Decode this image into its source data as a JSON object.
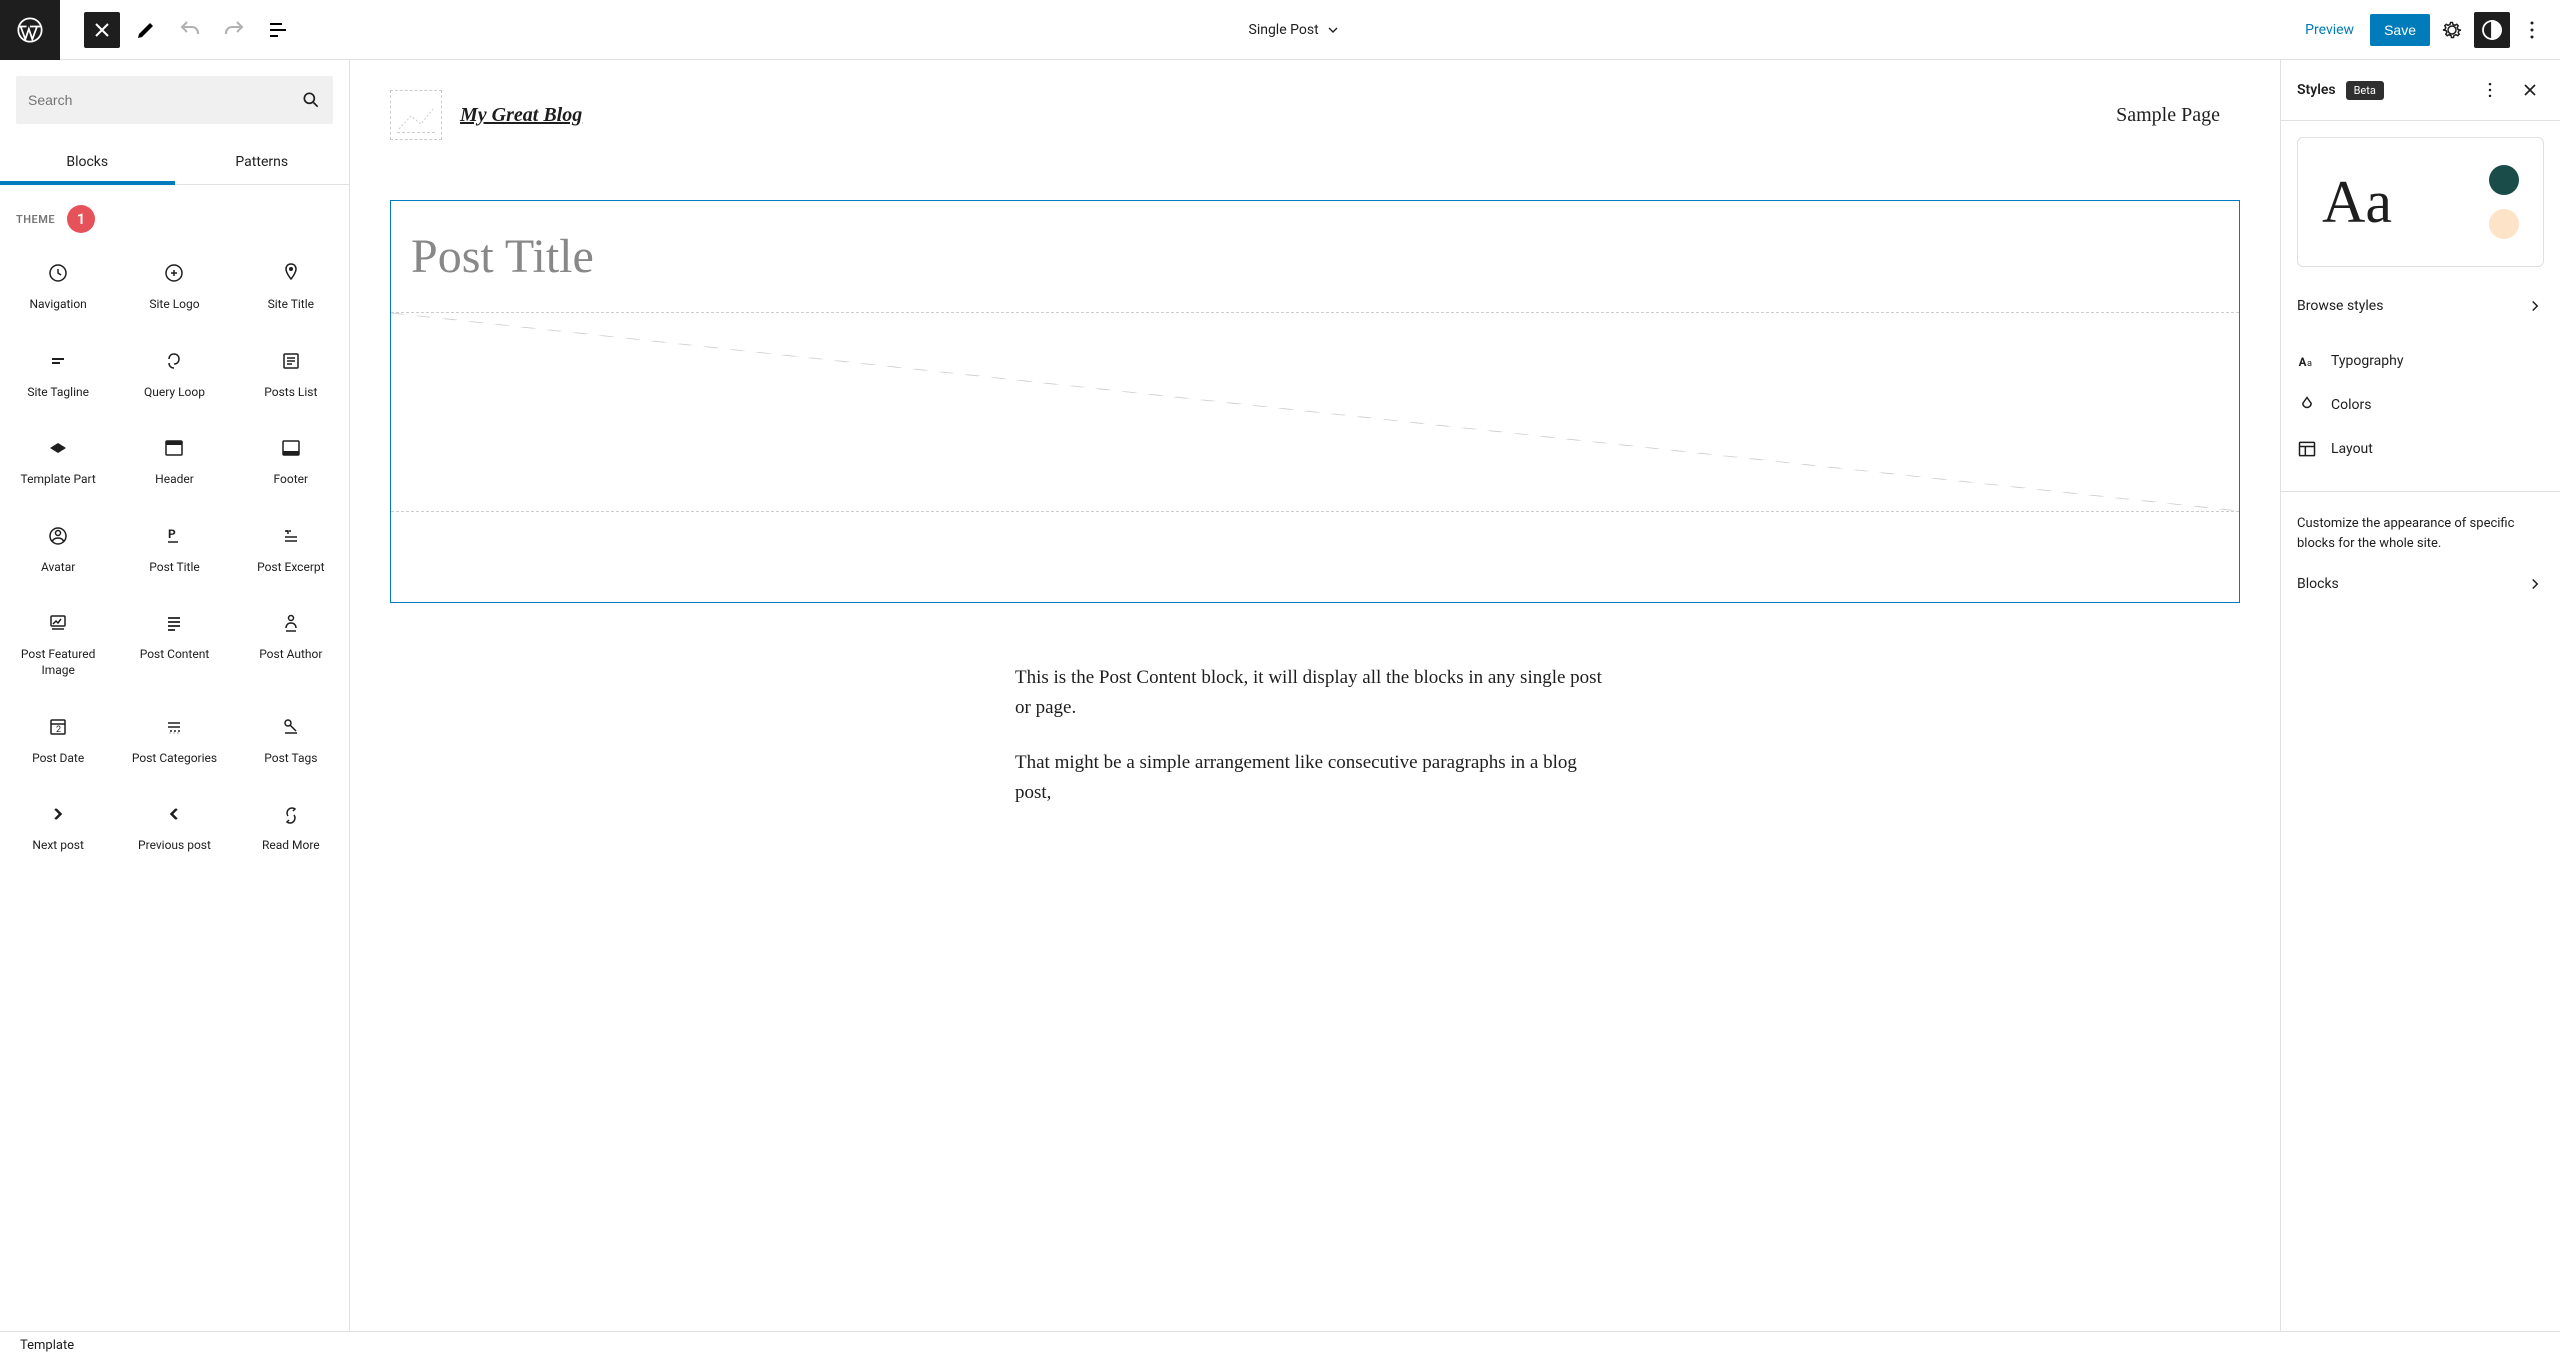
{
  "toolbar": {
    "template_name": "Single Post",
    "preview_label": "Preview",
    "save_label": "Save"
  },
  "inserter": {
    "search_placeholder": "Search",
    "tabs": {
      "blocks": "Blocks",
      "patterns": "Patterns"
    },
    "section_title": "THEME",
    "badge_number": "1",
    "blocks": [
      "Navigation",
      "Site Logo",
      "Site Title",
      "Site Tagline",
      "Query Loop",
      "Posts List",
      "Template Part",
      "Header",
      "Footer",
      "Avatar",
      "Post Title",
      "Post Excerpt",
      "Post Featured Image",
      "Post Content",
      "Post Author",
      "Post Date",
      "Post Categories",
      "Post Tags",
      "Next post",
      "Previous post",
      "Read More"
    ]
  },
  "canvas": {
    "site_title": "My Great Blog",
    "nav_item": "Sample Page",
    "post_title_placeholder": "Post Title",
    "content_p1": "This is the Post Content block, it will display all the blocks in any single post or page.",
    "content_p2": "That might be a simple arrangement like consecutive paragraphs in a blog post,"
  },
  "styles": {
    "title": "Styles",
    "beta": "Beta",
    "preview_text": "Aa",
    "colors": {
      "dark": "#1a4d4a",
      "light": "#fde3c8"
    },
    "browse_label": "Browse styles",
    "items": {
      "typography": "Typography",
      "colors": "Colors",
      "layout": "Layout"
    },
    "customize_text": "Customize the appearance of specific blocks for the whole site.",
    "blocks_label": "Blocks"
  },
  "footer": {
    "breadcrumb": "Template"
  }
}
